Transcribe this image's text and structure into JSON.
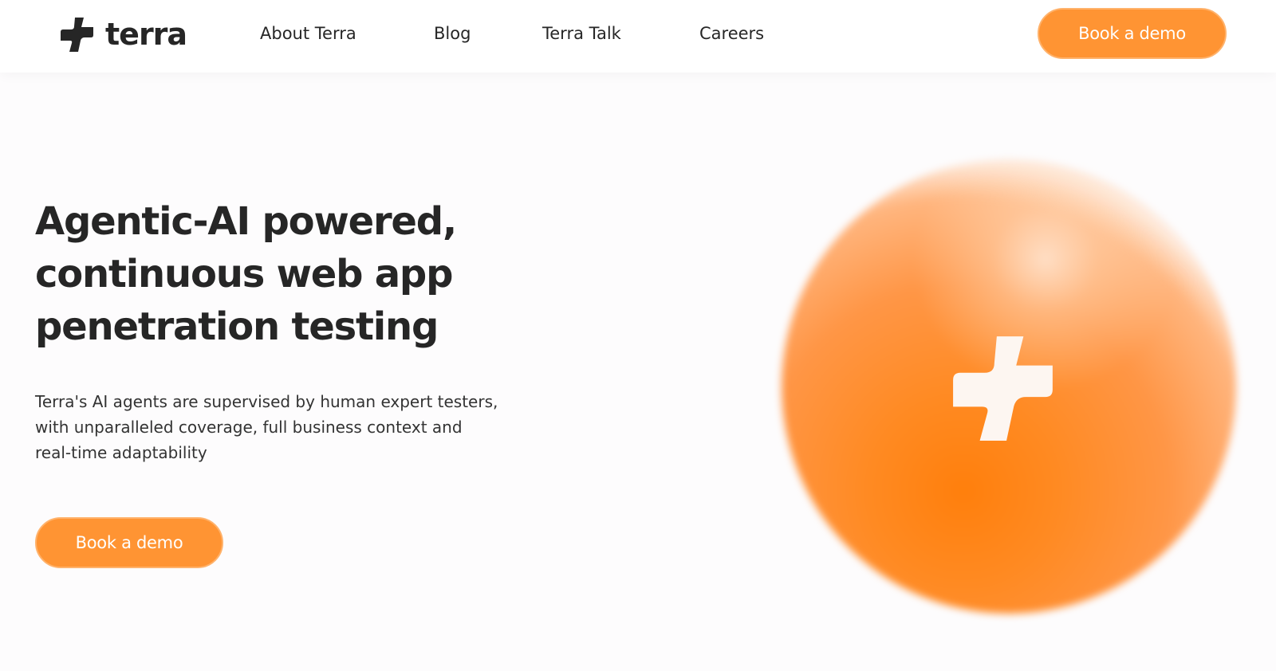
{
  "brand": {
    "name": "terra",
    "logo_icon": "terra-cross-logo-icon",
    "accent_color": "#ff9433",
    "text_color": "#262626"
  },
  "nav": {
    "items": [
      {
        "label": "About Terra"
      },
      {
        "label": "Blog"
      },
      {
        "label": "Terra Talk"
      },
      {
        "label": "Careers"
      }
    ],
    "cta_label": "Book a demo"
  },
  "hero": {
    "title_lines": [
      "Agentic-AI powered,",
      "continuous web app",
      "penetration testing"
    ],
    "description_lines": [
      "Terra's AI agents are supervised by human expert testers,",
      "with unparalleled coverage, full business context and",
      "real-time adaptability"
    ],
    "cta_label": "Book a demo",
    "graphic": "orange-orb-with-terra-cross-icon"
  }
}
